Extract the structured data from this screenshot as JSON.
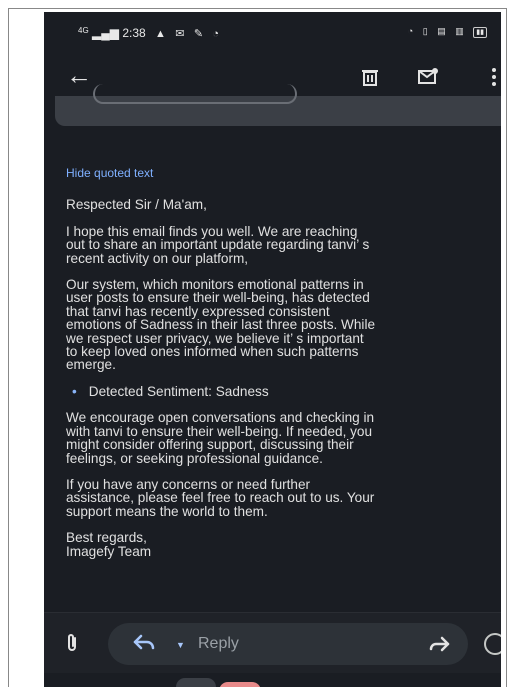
{
  "status_bar": {
    "signal": "4G",
    "time": "2:38"
  },
  "email": {
    "hide_quoted_label": "Hide quoted text",
    "greeting": "Respected Sir / Ma'am,",
    "paragraph1": [
      "I hope this email finds you well. We are reaching",
      "out to share an important update regarding tanvi’ s",
      "recent activity on our platform,"
    ],
    "paragraph2": [
      "Our system, which monitors emotional patterns in",
      "user posts to ensure their well-being, has detected",
      "that tanvi has recently expressed consistent",
      "emotions of Sadness in their last three posts. While",
      "we respect user privacy, we believe it’ s important",
      "to keep loved ones informed when such patterns",
      "emerge."
    ],
    "bullet": "Detected Sentiment: Sadness",
    "paragraph3": [
      "We encourage open conversations and checking in",
      "with tanvi to ensure their well-being. If needed, you",
      "might consider offering support, discussing their",
      "feelings, or seeking professional guidance."
    ],
    "paragraph4": [
      "If you have any concerns or need further",
      "assistance, please feel free to reach out to us. Your",
      "support means the world to them."
    ],
    "signoff": "Best regards,",
    "signature": "Imagefy Team"
  },
  "reply_bar": {
    "reply_label": "Reply"
  },
  "icons": {
    "back": "back-arrow-icon",
    "delete": "trash-icon",
    "mark_unread": "mail-unread-icon",
    "more": "more-vert-icon",
    "attach": "attachment-icon",
    "reply": "reply-icon",
    "forward": "forward-icon",
    "emoji": "emoji-icon"
  },
  "colors": {
    "background": "#1a1d23",
    "link": "#7fb0ff",
    "accent": "#8ab4f8"
  }
}
